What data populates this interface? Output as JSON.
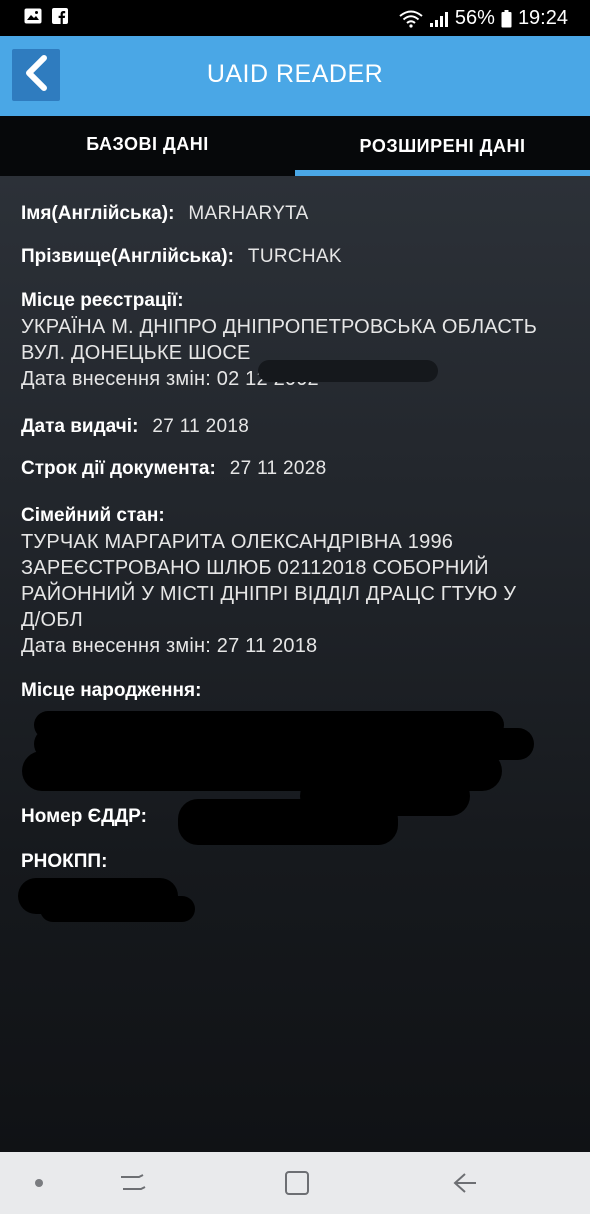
{
  "status_bar": {
    "left_icons": [
      "image-icon",
      "facebook-icon"
    ],
    "battery": "56%",
    "time": "19:24"
  },
  "app_bar": {
    "title": "UAID READER",
    "back_icon": "chevron-left-icon"
  },
  "tabs": [
    {
      "label": "БАЗОВІ ДАНІ",
      "active": false
    },
    {
      "label": "РОЗШИРЕНІ ДАНІ",
      "active": true
    }
  ],
  "fields": {
    "name_en": {
      "label": "Імя(Англійська):",
      "value": "MARHARYTA"
    },
    "surname_en": {
      "label": "Прізвище(Англійська):",
      "value": "TURCHAK"
    },
    "registration": {
      "label": "Місце реєстрації:",
      "value_line1": "УКРАЇНА М. ДНІПРО ДНІПРОПЕТРОВСЬКА ОБЛАСТЬ",
      "value_line2": "ВУЛ. ДОНЕЦЬКЕ ШОСЕ",
      "changed": "Дата внесення змін: 02 12 2002"
    },
    "issue_date": {
      "label": "Дата видачі:",
      "value": "27 11 2018"
    },
    "expiry_date": {
      "label": "Строк дії документа:",
      "value": "27 11 2028"
    },
    "marital": {
      "label": "Сімейний стан:",
      "value_line1": "ТУРЧАК МАРГАРИТА ОЛЕКСАНДРІВНА 1996",
      "value_line2": "ЗАРЕЄСТРОВАНО ШЛЮБ 02112018 СОБОРНИЙ",
      "value_line3": "РАЙОННИЙ У МІСТІ ДНІПРІ ВІДДІЛ ДРАЦС ГТУЮ У",
      "value_line4": "Д/ОБЛ",
      "changed": "Дата внесення змін: 27 11 2018"
    },
    "birth_place": {
      "label": "Місце народження:"
    },
    "eddr": {
      "label": "Номер ЄДДР:"
    },
    "rnokpp": {
      "label": "РНОКПП:"
    }
  },
  "nav_bar": {
    "items": [
      "dot-icon",
      "recent-apps-icon",
      "home-icon",
      "back-arrow-icon"
    ]
  }
}
